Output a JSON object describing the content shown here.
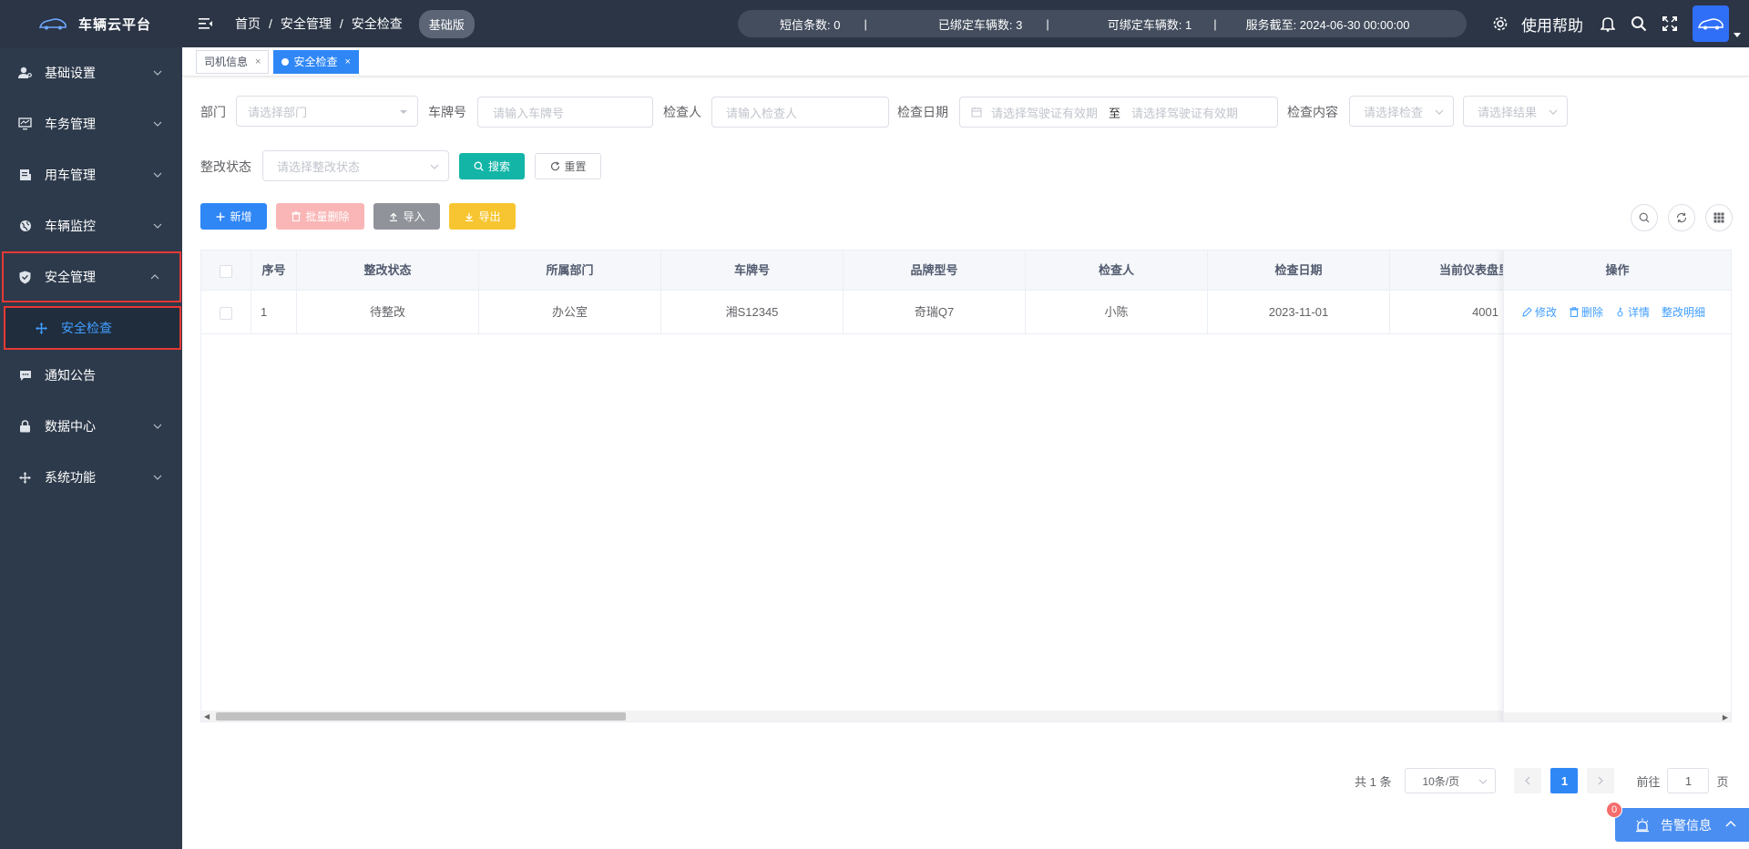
{
  "header": {
    "app_title": "车辆云平台",
    "breadcrumb": [
      "首页",
      "安全管理",
      "安全检查"
    ],
    "separator": "/",
    "version_badge": "基础版",
    "sms_label": "短信条数: 0",
    "bound_label": "已绑定车辆数: 3",
    "bindable_label": "可绑定车辆数: 1",
    "service_label": "服务截至: 2024-06-30 00:00:00",
    "pipe": "|",
    "help": "使用帮助"
  },
  "sidebar": {
    "items": [
      {
        "label": "基础设置",
        "icon": "user-settings-icon"
      },
      {
        "label": "车务管理",
        "icon": "monitor-icon"
      },
      {
        "label": "用车管理",
        "icon": "document-icon"
      },
      {
        "label": "车辆监控",
        "icon": "globe-icon"
      },
      {
        "label": "安全管理",
        "icon": "shield-icon"
      },
      {
        "label": "通知公告",
        "icon": "message-icon"
      },
      {
        "label": "数据中心",
        "icon": "lock-icon"
      },
      {
        "label": "系统功能",
        "icon": "move-icon"
      }
    ],
    "sub_active": "安全检查"
  },
  "tabs": [
    {
      "label": "司机信息",
      "close": "×"
    },
    {
      "label": "安全检查",
      "close": "×"
    }
  ],
  "filters": {
    "dept_label": "部门",
    "dept_placeholder": "请选择部门",
    "plate_label": "车牌号",
    "plate_placeholder": "请输入车牌号",
    "inspector_label": "检查人",
    "inspector_placeholder": "请输入检查人",
    "date_label": "检查日期",
    "date_start_placeholder": "请选择驾驶证有效期",
    "date_to": "至",
    "date_end_placeholder": "请选择驾驶证有效期",
    "content_label": "检查内容",
    "content_placeholder": "请选择检查",
    "result_placeholder": "请选择结果",
    "rectify_label": "整改状态",
    "rectify_placeholder": "请选择整改状态",
    "search_btn": "搜索",
    "reset_btn": "重置"
  },
  "toolbar": {
    "add": "新增",
    "batch_delete": "批量删除",
    "import": "导入",
    "export": "导出"
  },
  "table": {
    "headers": [
      "序号",
      "整改状态",
      "所属部门",
      "车牌号",
      "品牌型号",
      "检查人",
      "检查日期",
      "当前仪表盘里程",
      "操作"
    ],
    "rows": [
      {
        "index": "1",
        "status": "待整改",
        "dept": "办公室",
        "plate": "湘S12345",
        "model": "奇瑞Q7",
        "inspector": "小陈",
        "date": "2023-11-01",
        "mileage": "4001"
      }
    ],
    "actions": {
      "edit": "修改",
      "delete": "删除",
      "detail": "详情",
      "rectify": "整改明细"
    }
  },
  "pagination": {
    "total": "共 1 条",
    "page_size": "10条/页",
    "current_page": "1",
    "goto_label": "前往",
    "goto_value": "1",
    "page_unit": "页"
  },
  "alarm": {
    "label": "告警信息",
    "badge": "0"
  },
  "colors": {
    "header_bg": "#2b3546",
    "sidebar_bg": "#2d3a4b",
    "primary": "#2f87f6",
    "search_btn": "#13b5a7",
    "add_btn": "#2f87f6",
    "delete_btn": "#fab6b6",
    "import_btn": "#909399",
    "export_btn": "#f7c531",
    "highlight_border": "#e53935"
  }
}
